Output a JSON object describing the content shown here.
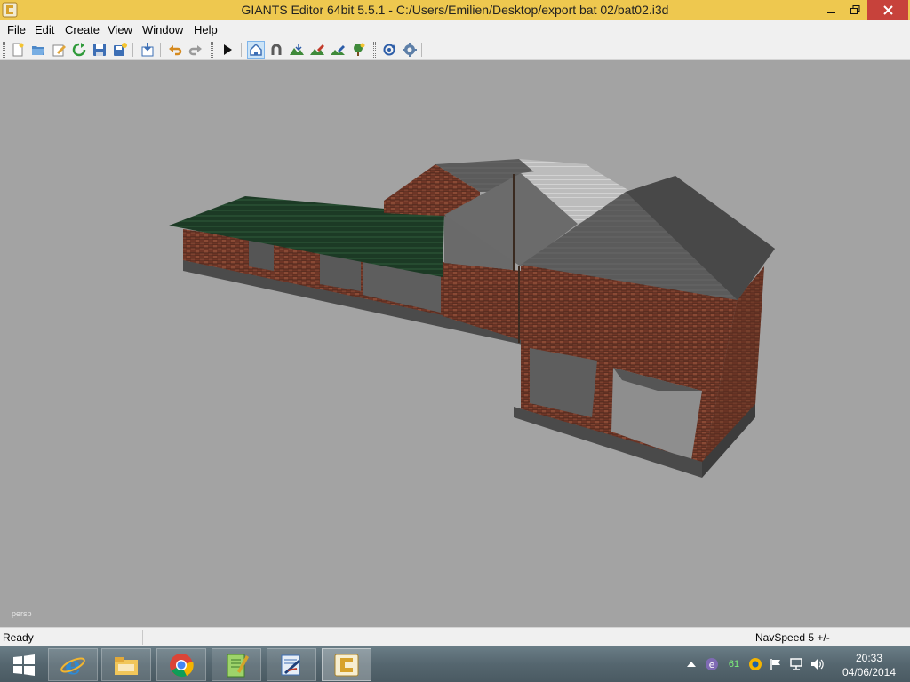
{
  "window": {
    "title": "GIANTS Editor 64bit 5.5.1 - C:/Users/Emilien/Desktop/export bat 02/bat02.i3d"
  },
  "menu": [
    "File",
    "Edit",
    "Create",
    "View",
    "Window",
    "Help"
  ],
  "toolbar": {
    "buttons": [
      "new-file-icon",
      "open-file-icon",
      "edit-file-icon",
      "refresh-icon",
      "save-icon",
      "save-as-icon",
      "import-icon",
      "undo-icon",
      "redo-icon",
      "play-icon",
      "select-mode-icon",
      "magnet-icon",
      "terrain-sculpt-icon",
      "paint-icon",
      "foliage-paint-icon",
      "place-tree-icon",
      "rotate-camera-icon",
      "camera-settings-icon"
    ],
    "active": "select-mode-icon"
  },
  "viewport": {
    "label": "persp",
    "background": "#a3a3a3"
  },
  "status": {
    "text": "Ready",
    "navspeed": "NavSpeed 5 +/-"
  },
  "taskbar": {
    "apps": [
      "start-button",
      "internet-explorer-icon",
      "file-explorer-icon",
      "chrome-icon",
      "notepad-plus-plus-icon",
      "editor-tool-icon",
      "giants-editor-icon"
    ],
    "tray": [
      "show-hidden-icons",
      "torrent-icon",
      "gpu-temp-icon",
      "sync-icon",
      "action-center-flag-icon",
      "network-icon",
      "volume-icon"
    ],
    "tray_temp": "61",
    "clock_time": "20:33",
    "clock_date": "04/06/2014"
  },
  "colors": {
    "titlebar": "#eec84f",
    "close": "#c7423b",
    "brick": "#7a3a28",
    "roof_green": "#1e3a26",
    "roof_grey": "#555555"
  }
}
